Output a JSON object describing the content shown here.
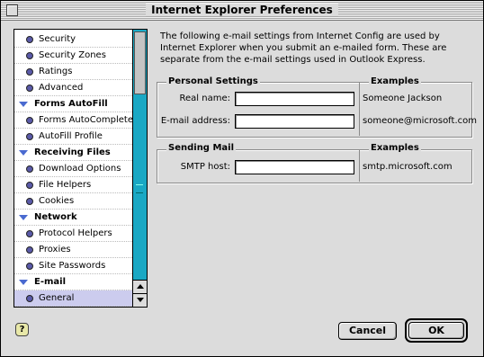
{
  "window": {
    "title": "Internet Explorer Preferences"
  },
  "sidebar": {
    "items": [
      {
        "label": "Security",
        "type": "item"
      },
      {
        "label": "Security Zones",
        "type": "item"
      },
      {
        "label": "Ratings",
        "type": "item"
      },
      {
        "label": "Advanced",
        "type": "item"
      },
      {
        "label": "Forms AutoFill",
        "type": "category"
      },
      {
        "label": "Forms AutoComplete",
        "type": "item"
      },
      {
        "label": "AutoFill Profile",
        "type": "item"
      },
      {
        "label": "Receiving Files",
        "type": "category"
      },
      {
        "label": "Download Options",
        "type": "item"
      },
      {
        "label": "File Helpers",
        "type": "item"
      },
      {
        "label": "Cookies",
        "type": "item"
      },
      {
        "label": "Network",
        "type": "category"
      },
      {
        "label": "Protocol Helpers",
        "type": "item"
      },
      {
        "label": "Proxies",
        "type": "item"
      },
      {
        "label": "Site Passwords",
        "type": "item"
      },
      {
        "label": "E-mail",
        "type": "category"
      },
      {
        "label": "General",
        "type": "item",
        "selected": true
      }
    ]
  },
  "main": {
    "description": "The following e-mail settings from Internet Config are used by Internet Explorer when you submit an e-mailed form.  These are separate from the e-mail settings used in Outlook Express.",
    "personal": {
      "title": "Personal Settings",
      "examples_title": "Examples",
      "real_name_label": "Real name:",
      "real_name_value": "",
      "real_name_example": "Someone Jackson",
      "email_label": "E-mail address:",
      "email_value": "",
      "email_example": "someone@microsoft.com"
    },
    "sending": {
      "title": "Sending Mail",
      "examples_title": "Examples",
      "smtp_label": "SMTP host:",
      "smtp_value": "",
      "smtp_example": "smtp.microsoft.com"
    }
  },
  "buttons": {
    "cancel": "Cancel",
    "ok": "OK",
    "help": "?"
  },
  "colors": {
    "scrollbar": "#1aa8c4",
    "bullet": "#5a5aa8",
    "selected": "#ccccee"
  }
}
